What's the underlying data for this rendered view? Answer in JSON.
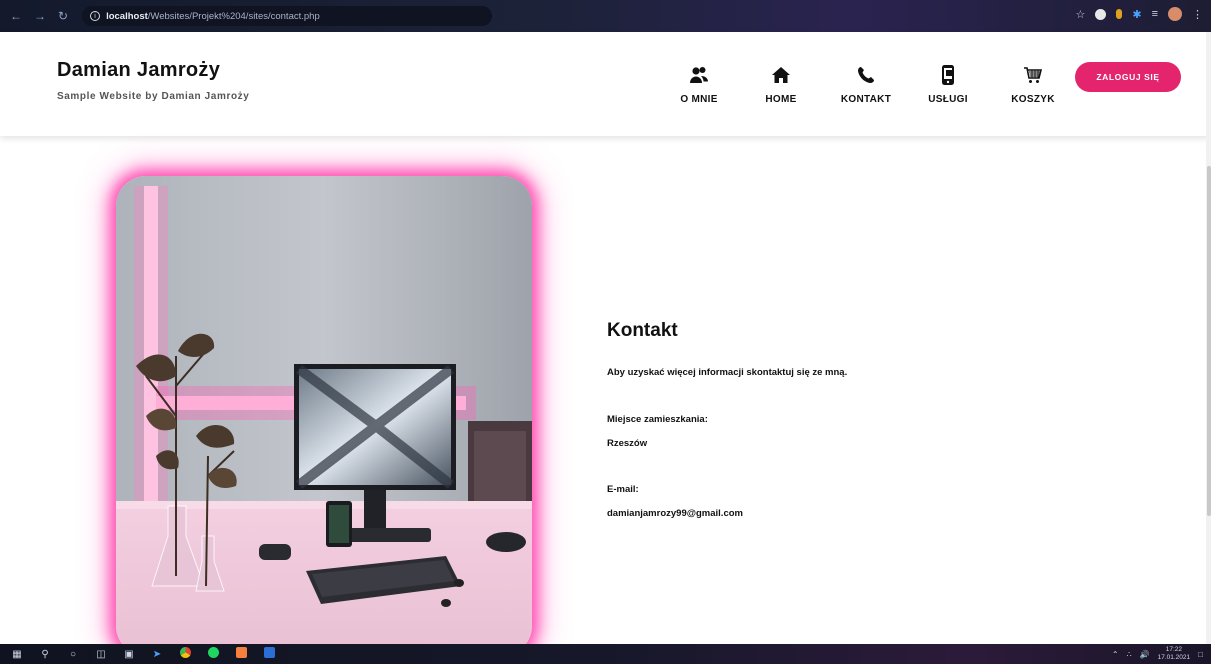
{
  "browser": {
    "url_host": "localhost",
    "url_path": "/Websites/Projekt%204/sites/contact.php"
  },
  "header": {
    "title": "Damian Jamroży",
    "subtitle": "Sample Website by Damian Jamroży",
    "nav": [
      {
        "label": "O MNIE",
        "icon": "users-icon"
      },
      {
        "label": "HOME",
        "icon": "home-icon"
      },
      {
        "label": "KONTAKT",
        "icon": "phone-icon"
      },
      {
        "label": "USŁUGI",
        "icon": "mobile-icon"
      },
      {
        "label": "KOSZYK",
        "icon": "cart-icon"
      }
    ],
    "login_label": "ZALOGUJ SIĘ"
  },
  "contact": {
    "title": "Kontakt",
    "intro": "Aby uzyskać więcej informacji skontaktuj się ze mną.",
    "residence_label": "Miejsce zamieszkania:",
    "residence_value": "Rzeszów",
    "email_label": "E-mail:",
    "email_value": "damianjamrozy99@gmail.com"
  },
  "taskbar": {
    "time": "17:22",
    "date": "17.01.2021"
  },
  "colors": {
    "accent": "#e5246e",
    "glow": "#ff3cb4"
  }
}
